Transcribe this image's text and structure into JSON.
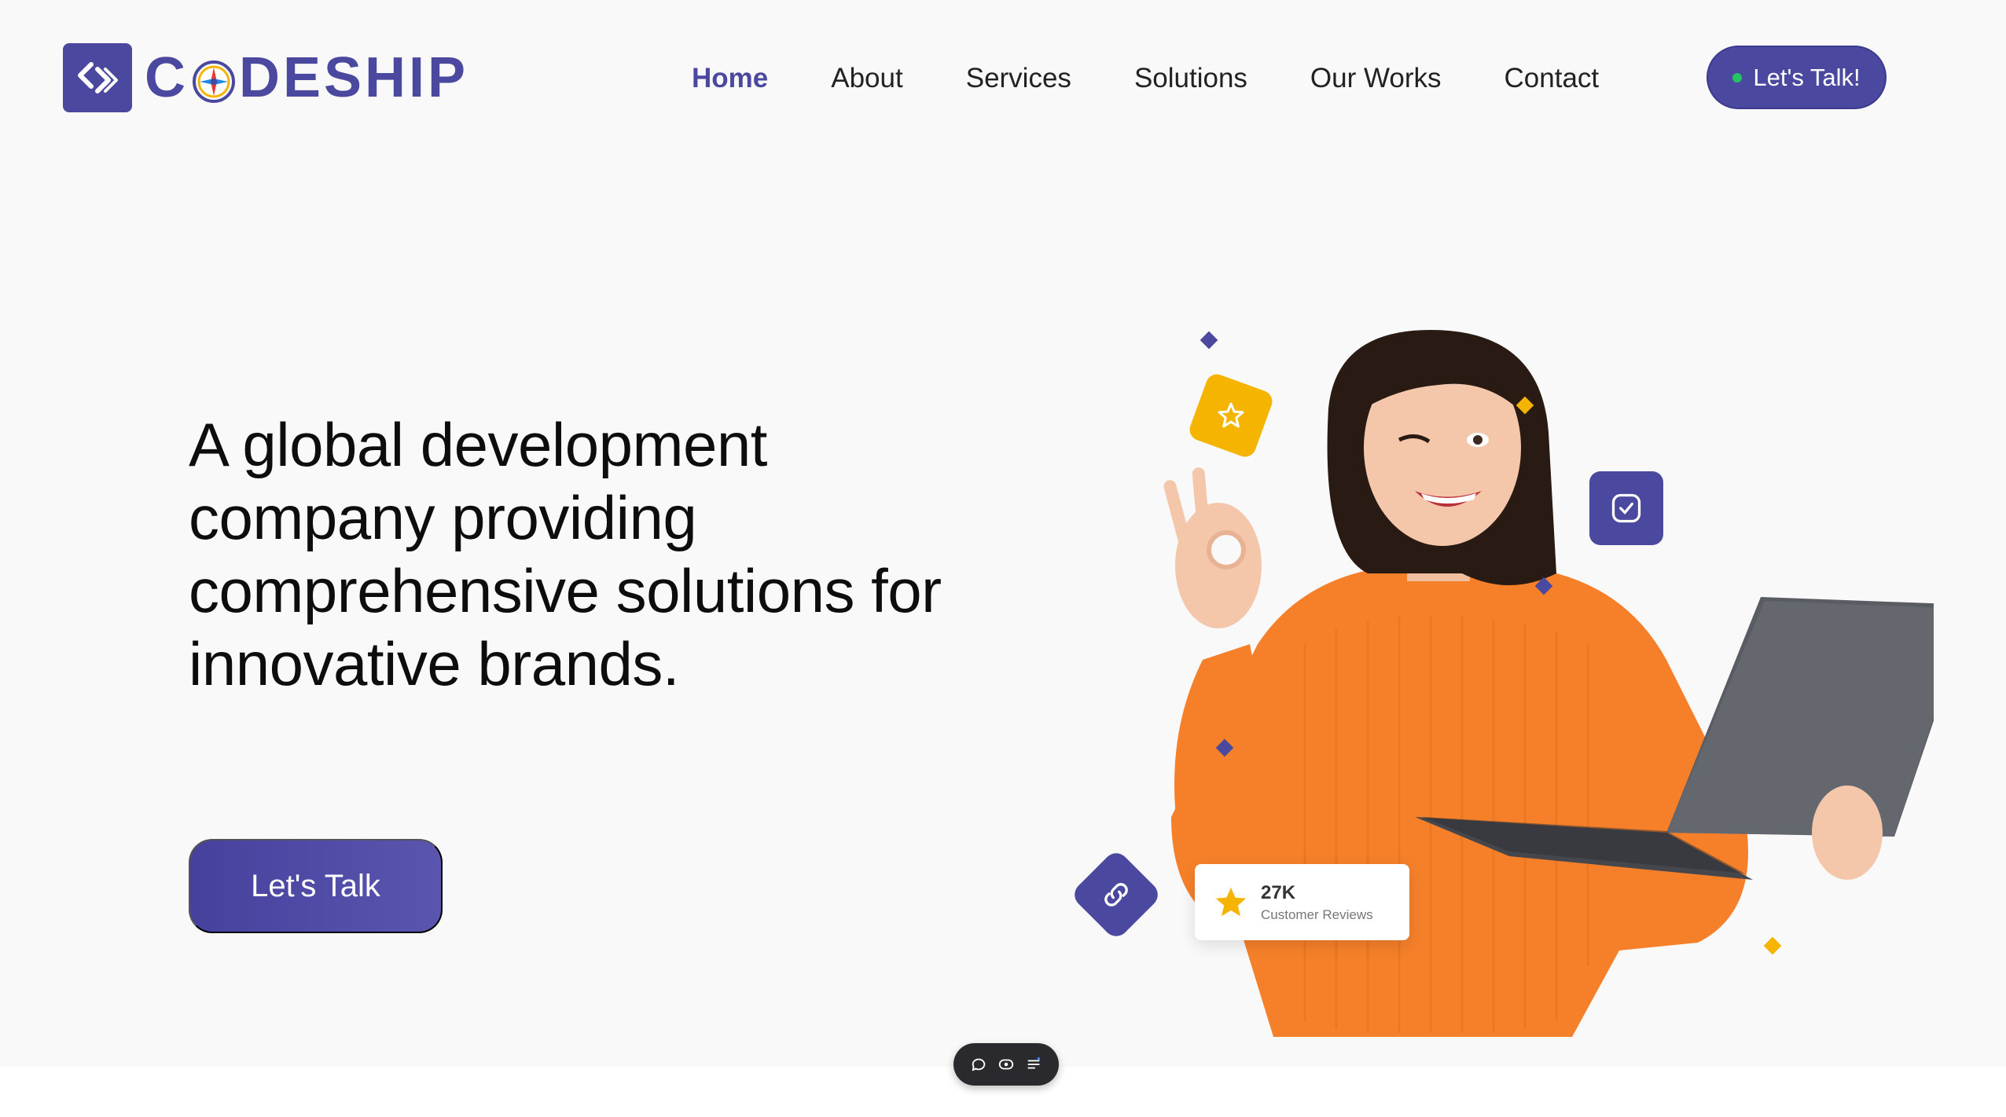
{
  "brand": {
    "name_prefix": "C",
    "name_suffix": "DESHIP",
    "primary": "#4b48a0",
    "accent_yellow": "#f5b400",
    "status_green": "#22c55e"
  },
  "nav": {
    "items": [
      {
        "label": "Home",
        "active": true
      },
      {
        "label": "About",
        "active": false
      },
      {
        "label": "Services",
        "active": false
      },
      {
        "label": "Solutions",
        "active": false
      },
      {
        "label": "Our Works",
        "active": false
      },
      {
        "label": "Contact",
        "active": false
      }
    ],
    "cta_label": "Let's Talk!"
  },
  "hero": {
    "title": "A global development company providing comprehensive solutions for innovative brands.",
    "cta_label": "Let's Talk"
  },
  "reviews": {
    "count": "27K",
    "label": "Customer Reviews"
  },
  "icons": [
    "logo-arrows-icon",
    "compass-icon",
    "star-icon",
    "checkbox-icon",
    "link-icon",
    "chat-icon",
    "eye-icon",
    "list-icon"
  ]
}
